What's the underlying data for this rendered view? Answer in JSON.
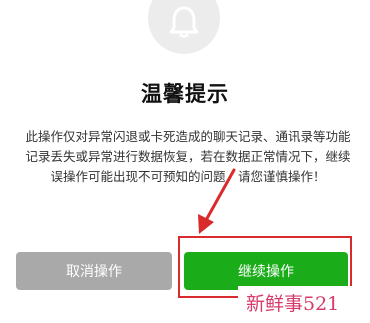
{
  "dialog": {
    "icon": "bell-icon",
    "title": "温馨提示",
    "message": "此操作仅对异常闪退或卡死造成的聊天记录、通讯录等功能记录丢失或异常进行数据恢复，若在数据正常情况下，继续误操作可能出现不可预知的问题，请您谨慎操作！",
    "cancel_label": "取消操作",
    "continue_label": "继续操作"
  },
  "overlay": {
    "annotation_color": "#d92b2b",
    "watermark": "新鲜事521"
  },
  "colors": {
    "continue_button": "#1aad19",
    "cancel_button": "#a9a9a9"
  }
}
